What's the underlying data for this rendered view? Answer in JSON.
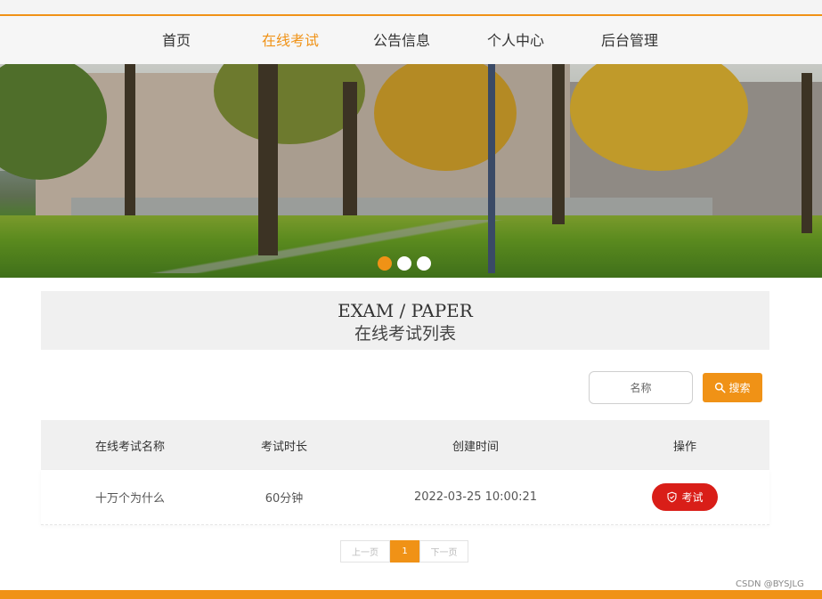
{
  "nav": {
    "items": [
      {
        "label": "首页",
        "active": false
      },
      {
        "label": "在线考试",
        "active": true
      },
      {
        "label": "公告信息",
        "active": false
      },
      {
        "label": "个人中心",
        "active": false
      },
      {
        "label": "后台管理",
        "active": false
      }
    ]
  },
  "banner": {
    "slide_count": 3,
    "active_slide": 1
  },
  "section": {
    "title_en": "EXAM / PAPER",
    "title_cn": "在线考试列表"
  },
  "search": {
    "placeholder": "名称",
    "button_label": "搜索"
  },
  "table": {
    "headers": [
      "在线考试名称",
      "考试时长",
      "创建时间",
      "操作"
    ],
    "rows": [
      {
        "name": "十万个为什么",
        "duration": "60分钟",
        "created": "2022-03-25 10:00:21",
        "action": "考试"
      }
    ]
  },
  "pagination": {
    "prev": "上一页",
    "current": "1",
    "next": "下一页"
  },
  "watermark": "CSDN @BYSJLG",
  "colors": {
    "accent": "#f09216",
    "danger": "#d91e18"
  }
}
